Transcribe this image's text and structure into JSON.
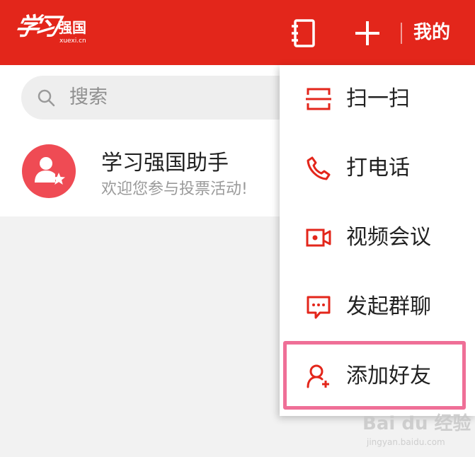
{
  "header": {
    "logo_calligraphy": "学习",
    "logo_name": "强国",
    "logo_sub": "xuexi.cn",
    "mine_label": "我的",
    "bg_color": "#e3261b",
    "icons": [
      "address-book-icon",
      "plus-icon"
    ]
  },
  "search": {
    "placeholder": "搜索"
  },
  "chats": [
    {
      "name": "学习强国助手",
      "preview": "欢迎您参与投票活动!",
      "avatar_color": "#ef4b54",
      "avatar_icon": "user-star-icon"
    }
  ],
  "menu": {
    "items": [
      {
        "label": "扫一扫",
        "icon": "scan-icon"
      },
      {
        "label": "打电话",
        "icon": "phone-icon"
      },
      {
        "label": "视频会议",
        "icon": "video-camera-icon"
      },
      {
        "label": "发起群聊",
        "icon": "chat-bubble-icon"
      },
      {
        "label": "添加好友",
        "icon": "add-friend-icon",
        "highlighted": true
      }
    ],
    "icon_color": "#e3261b",
    "highlight_color": "#ef6f97"
  },
  "watermark": {
    "main": "Bai du 经验",
    "sub": "jingyan.baidu.com"
  }
}
